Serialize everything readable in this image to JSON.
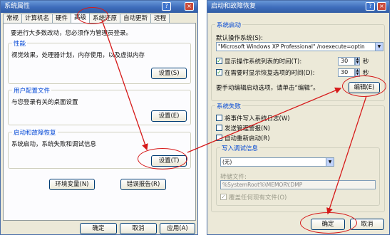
{
  "left_window": {
    "title": "系统属性",
    "tabs": [
      "常规",
      "计算机名",
      "硬件",
      "高级",
      "系统还原",
      "自动更新",
      "远程"
    ],
    "intro": "要进行大多数改动，您必须作为管理员登录。",
    "performance": {
      "title": "性能",
      "desc": "视觉效果，处理器计划，内存使用，以及虚拟内存",
      "button": "设置(S)"
    },
    "user_profiles": {
      "title": "用户配置文件",
      "desc": "与您登录有关的桌面设置",
      "button": "设置(E)"
    },
    "startup_recovery": {
      "title": "启动和故障恢复",
      "desc": "系统启动，系统失败和调试信息",
      "button": "设置(T)"
    },
    "env_vars_button": "环境变量(N)",
    "error_report_button": "错误报告(R)",
    "ok_button": "确定",
    "cancel_button": "取消",
    "apply_button": "应用(A)"
  },
  "right_window": {
    "title": "启动和故障恢复",
    "system_startup": {
      "title": "系统启动",
      "default_os_label": "默认操作系统(S):",
      "default_os_value": "\"Microsoft Windows XP Professional\" /noexecute=optin",
      "show_os_list_label": "显示操作系统列表的时间(T):",
      "show_os_list_value": "30",
      "show_recovery_label": "在需要时显示恢复选项的时间(D):",
      "show_recovery_value": "30",
      "seconds": "秒",
      "manual_edit_text": "要手动编辑启动选项，请单击“编辑”。",
      "edit_button": "编辑(E)"
    },
    "system_failure": {
      "title": "系统失败",
      "write_event_label": "将事件写入系统日志(W)",
      "send_alert_label": "发送管理警报(N)",
      "auto_restart_label": "自动重新启动(R)",
      "debug_info_title": "写入调试信息",
      "debug_info_value": "(无)",
      "dump_file_label": "转储文件:",
      "dump_file_value": "%SystemRoot%\\MEMORY.DMP",
      "overwrite_label": "覆盖任何现有文件(O)"
    },
    "ok_button": "确定",
    "cancel_button": "取消"
  },
  "colors": {
    "highlight": "#d61a1a",
    "xp_blue": "#2b5fb8",
    "dialog_bg": "#ece9d8"
  }
}
